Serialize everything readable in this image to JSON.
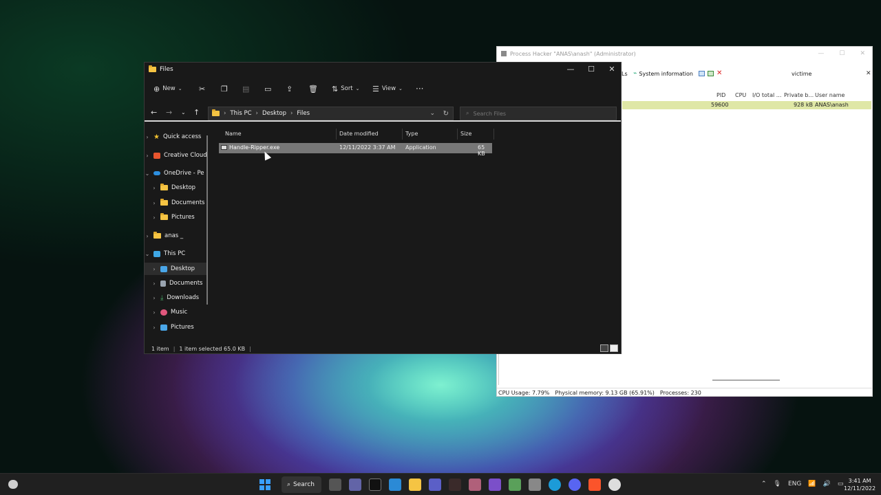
{
  "process_hacker": {
    "title": "Process Hacker \"ANAS\\anash\" (Administrator)",
    "toolbar_partial": "Ls",
    "system_information_label": "System information",
    "search_value": "victime",
    "columns": {
      "pid": "PID",
      "cpu": "CPU",
      "io_total": "I/O total ...",
      "private_bytes": "Private b...",
      "user_name": "User name"
    },
    "row": {
      "pid": "59600",
      "private_bytes": "928 kB",
      "user_name": "ANAS\\anash"
    },
    "status": {
      "cpu_usage": "CPU Usage: 7.79%",
      "physical_memory": "Physical memory: 9.13 GB (65.91%)",
      "processes": "Processes: 230"
    }
  },
  "explorer": {
    "title": "Files",
    "commands": {
      "new": "New",
      "sort": "Sort",
      "view": "View"
    },
    "breadcrumb": [
      "This PC",
      "Desktop",
      "Files"
    ],
    "search_placeholder": "Search Files",
    "nav": [
      {
        "label": "Quick access",
        "icon": "star-icon",
        "color": "#f2c230"
      },
      {
        "label": "Creative Cloud",
        "icon": "cloud-files-icon",
        "color": "#e8552e"
      },
      {
        "label": "OneDrive - Pe",
        "icon": "onedrive-icon",
        "color": "#2d8fe0"
      },
      {
        "label": "Desktop",
        "icon": "folder-icon",
        "color": "#f5c443"
      },
      {
        "label": "Documents",
        "icon": "folder-icon",
        "color": "#f5c443"
      },
      {
        "label": "Pictures",
        "icon": "folder-icon",
        "color": "#f5c443"
      },
      {
        "label": "anas _",
        "icon": "folder-icon",
        "color": "#f5c443"
      },
      {
        "label": "This PC",
        "icon": "pc-icon",
        "color": "#3fa7e5"
      },
      {
        "label": "Desktop",
        "icon": "desktop-icon",
        "color": "#4aa6e8"
      },
      {
        "label": "Documents",
        "icon": "documents-icon",
        "color": "#9aa4b0"
      },
      {
        "label": "Downloads",
        "icon": "download-icon",
        "color": "#49b26b"
      },
      {
        "label": "Music",
        "icon": "music-icon",
        "color": "#e0577d"
      },
      {
        "label": "Pictures",
        "icon": "pictures-icon",
        "color": "#4aa6e8"
      }
    ],
    "columns": {
      "name": "Name",
      "date_modified": "Date modified",
      "type": "Type",
      "size": "Size"
    },
    "file": {
      "name": "Handle-Ripper.exe",
      "date": "12/11/2022 3:37 AM",
      "type": "Application",
      "size": "65 KB"
    },
    "status": {
      "count": "1 item",
      "selected": "1 item selected  65.0 KB"
    }
  },
  "taskbar": {
    "search_label": "Search",
    "language": "ENG",
    "time": "3:41 AM",
    "date": "12/11/2022"
  }
}
